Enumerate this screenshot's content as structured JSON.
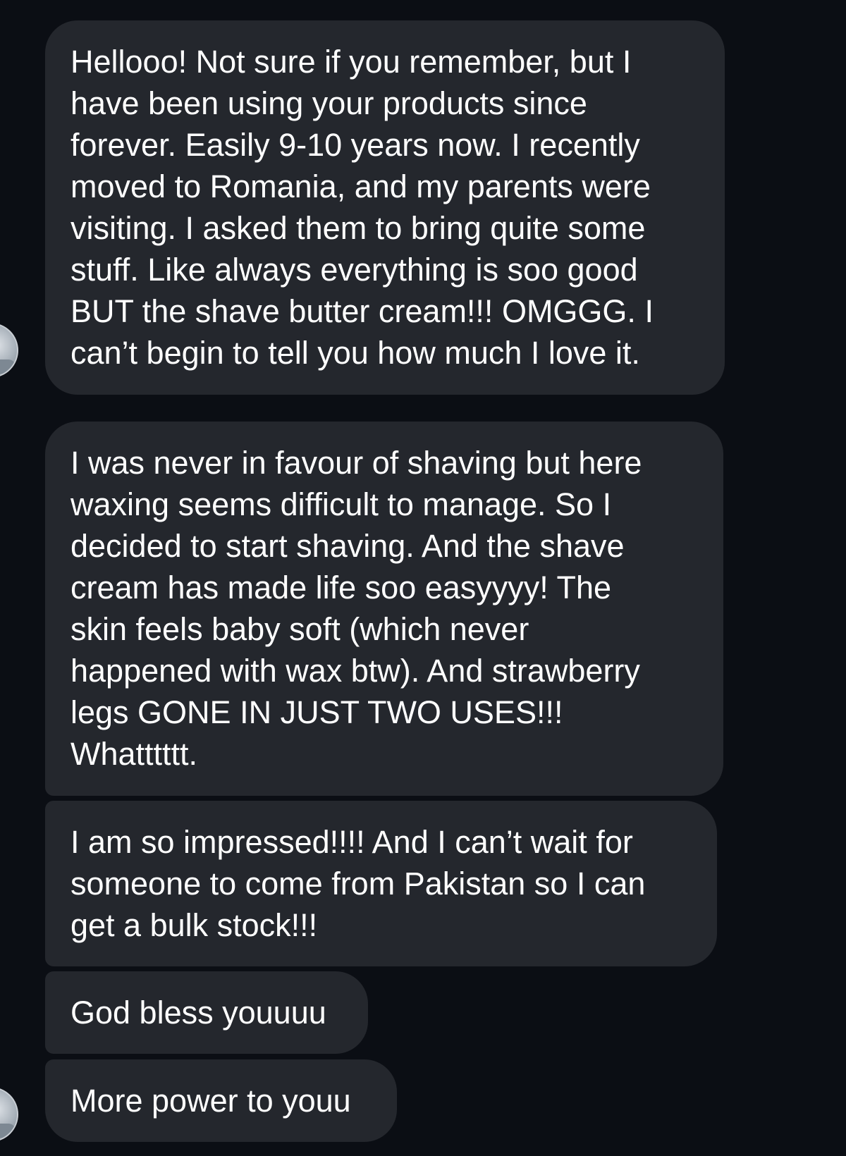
{
  "conversation": {
    "messages": [
      {
        "text": "Hellooo! Not sure if you remember, but I\nhave been using your products since\nforever. Easily 9-10 years now. I recently\nmoved to Romania, and my parents were\nvisiting. I asked them to bring quite some\nstuff. Like always everything is soo good\nBUT the shave butter cream!!! OMGGG. I\ncan’t begin to tell you how much I love it."
      },
      {
        "text": "I was never in favour of shaving but here\nwaxing seems difficult to manage. So I\ndecided to start shaving. And the shave\ncream has made life soo easyyyy! The\nskin feels baby soft (which never\nhappened with wax btw). And strawberry\nlegs GONE IN JUST TWO USES!!!\nWhatttttt."
      },
      {
        "text": "I am so impressed!!!! And I can’t wait for\nsomeone to come from Pakistan so I can\nget a bulk stock!!!"
      },
      {
        "text": "God bless youuuu"
      },
      {
        "text": "More power to youu"
      }
    ],
    "sender_avatar_icon": "profile-photo-icon"
  },
  "colors": {
    "background": "#0b0e14",
    "bubble": "#24272d",
    "text": "#ffffff"
  }
}
